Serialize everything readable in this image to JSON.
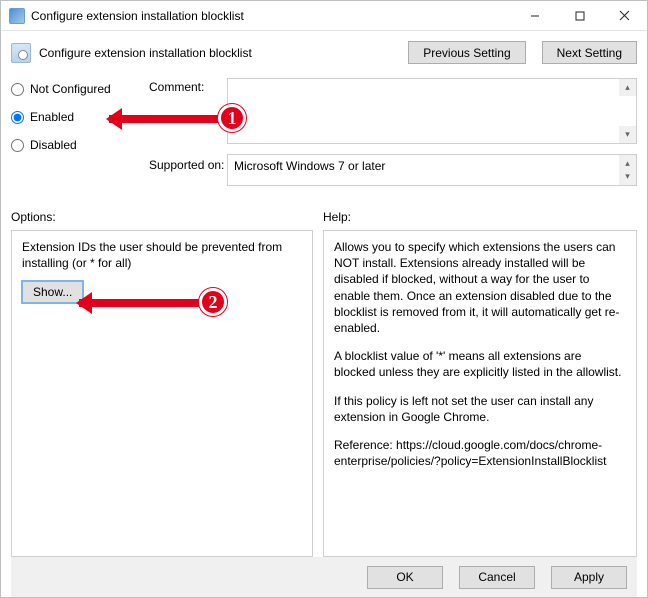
{
  "titlebar": {
    "title": "Configure extension installation blocklist"
  },
  "header": {
    "heading": "Configure extension installation blocklist",
    "prev": "Previous Setting",
    "next": "Next Setting"
  },
  "radios": {
    "not_configured": "Not Configured",
    "enabled": "Enabled",
    "disabled": "Disabled",
    "selected": "enabled"
  },
  "labels": {
    "comment": "Comment:",
    "supported_on": "Supported on:",
    "options": "Options:",
    "help": "Help:"
  },
  "supported_on_value": "Microsoft Windows 7 or later",
  "options_pane": {
    "text": "Extension IDs the user should be prevented from installing (or * for all)",
    "show_button": "Show..."
  },
  "help_pane": {
    "p1": "Allows you to specify which extensions the users can NOT install. Extensions already installed will be disabled if blocked, without a way for the user to enable them. Once an extension disabled due to the blocklist is removed from it, it will automatically get re-enabled.",
    "p2": "A blocklist value of '*' means all extensions are blocked unless they are explicitly listed in the allowlist.",
    "p3": "If this policy is left not set the user can install any extension in Google Chrome.",
    "p4": "Reference: https://cloud.google.com/docs/chrome-enterprise/policies/?policy=ExtensionInstallBlocklist"
  },
  "footer": {
    "ok": "OK",
    "cancel": "Cancel",
    "apply": "Apply"
  },
  "annotations": {
    "a1": "1",
    "a2": "2"
  }
}
